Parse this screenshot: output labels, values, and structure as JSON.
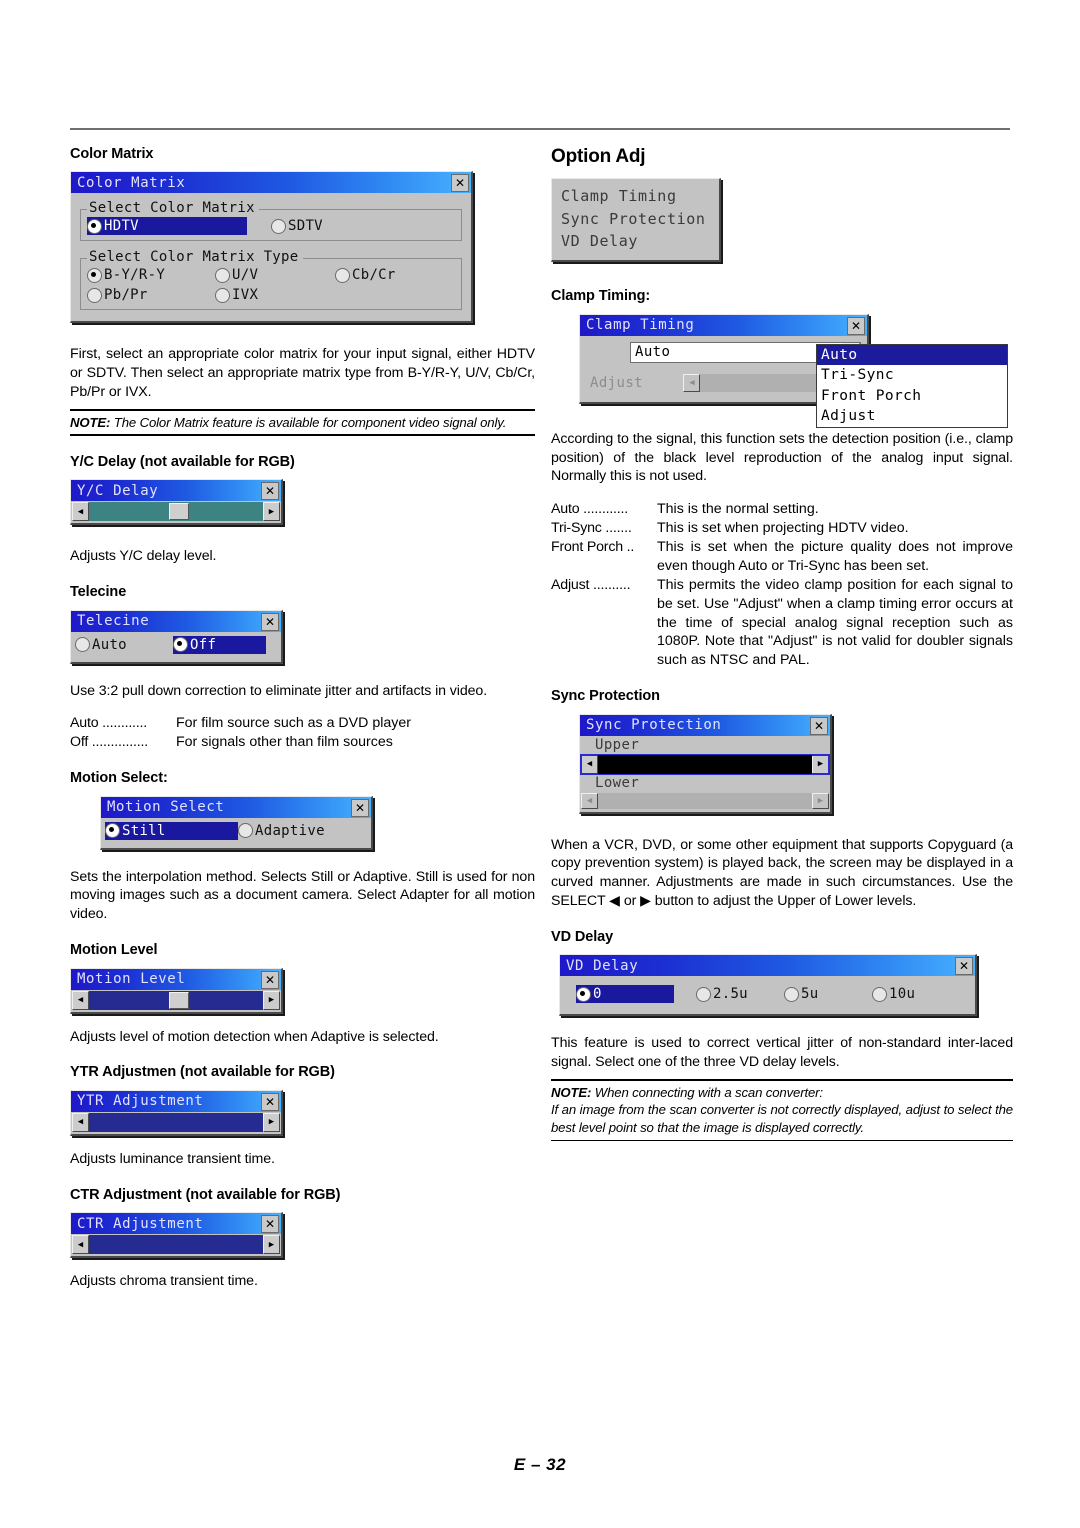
{
  "page": {
    "footer": "E – 32"
  },
  "left": {
    "color_matrix": {
      "heading": "Color Matrix",
      "dialog": {
        "title": "Color Matrix",
        "close_icon": "close-icon",
        "group1_legend": "Select Color Matrix",
        "group1_options": [
          {
            "label": "HDTV",
            "selected": true
          },
          {
            "label": "SDTV",
            "selected": false
          }
        ],
        "group2_legend": "Select Color Matrix Type",
        "group2_options": [
          {
            "label": "B-Y/R-Y",
            "selected": true
          },
          {
            "label": "U/V",
            "selected": false
          },
          {
            "label": "Cb/Cr",
            "selected": false
          },
          {
            "label": "Pb/Pr",
            "selected": false
          },
          {
            "label": "IVX",
            "selected": false
          }
        ]
      },
      "body": "First, select an appropriate color matrix for your input signal, either HDTV or SDTV. Then select an appropriate matrix type from B-Y/R-Y, U/V, Cb/Cr, Pb/Pr or IVX.",
      "note_prefix": "NOTE:",
      "note_text": " The Color Matrix feature is available for component video signal only."
    },
    "yc_delay": {
      "heading": "Y/C Delay (not available for RGB)",
      "dialog": {
        "title": "Y/C Delay",
        "close_icon": "close-icon"
      },
      "body": "Adjusts Y/C delay level."
    },
    "telecine": {
      "heading": "Telecine",
      "dialog": {
        "title": "Telecine",
        "close_icon": "close-icon",
        "options": [
          {
            "label": "Auto",
            "selected": false
          },
          {
            "label": "Off",
            "selected": true
          }
        ]
      },
      "body": "Use 3:2 pull down correction to eliminate jitter and artifacts in video.",
      "defs": [
        {
          "term": "Auto ............",
          "desc": "For film source such as a DVD player"
        },
        {
          "term": "Off ...............",
          "desc": "For signals other than film sources"
        }
      ]
    },
    "motion_select": {
      "heading": "Motion Select:",
      "dialog": {
        "title": "Motion Select",
        "close_icon": "close-icon",
        "options": [
          {
            "label": "Still",
            "selected": true
          },
          {
            "label": "Adaptive",
            "selected": false
          }
        ]
      },
      "body": "Sets the interpolation method. Selects Still or Adaptive. Still is used for non moving images such as a document camera. Select Adapter for all motion video."
    },
    "motion_level": {
      "heading": "Motion Level",
      "dialog": {
        "title": "Motion Level",
        "close_icon": "close-icon"
      },
      "body": "Adjusts level of motion detection when Adaptive is selected."
    },
    "ytr": {
      "heading": "YTR Adjustmen (not available for RGB)",
      "dialog": {
        "title": "YTR Adjustment",
        "close_icon": "close-icon"
      },
      "body": "Adjusts luminance transient time."
    },
    "ctr": {
      "heading": "CTR Adjustment (not available for RGB)",
      "dialog": {
        "title": "CTR Adjustment",
        "close_icon": "close-icon"
      },
      "body": "Adjusts chroma transient time."
    }
  },
  "right": {
    "option_adj": {
      "heading": "Option Adj",
      "menu_items": [
        "Clamp Timing",
        "Sync Protection",
        "VD Delay"
      ]
    },
    "clamp_timing": {
      "heading": "Clamp Timing:",
      "dialog": {
        "title": "Clamp Timing",
        "close_icon": "close-icon",
        "combo_value": "Auto",
        "combo_arrow_icon": "chevron-right-icon",
        "dropdown_options": [
          {
            "label": "Auto",
            "selected": true
          },
          {
            "label": "Tri-Sync",
            "selected": false
          },
          {
            "label": "Front Porch",
            "selected": false
          },
          {
            "label": "Adjust",
            "selected": false
          }
        ],
        "adjust_label": "Adjust"
      },
      "body": "According to the signal, this function sets the detection position (i.e., clamp position) of the black level reproduction of the analog input signal. Normally this is not used.",
      "defs": [
        {
          "term": "Auto ............",
          "desc": "This is the normal setting."
        },
        {
          "term": "Tri-Sync .......",
          "desc": "This is set when projecting HDTV video."
        },
        {
          "term": "Front Porch ..",
          "desc": "This is set when the picture quality does not improve even though Auto or Tri-Sync has been set."
        },
        {
          "term": "Adjust ..........",
          "desc": "This permits the video clamp position for each signal to be set. Use \"Adjust\" when a clamp timing error occurs at the time of special analog signal reception such as 1080P. Note that \"Adjust\" is not valid for doubler signals such as NTSC and PAL."
        }
      ]
    },
    "sync_protection": {
      "heading": "Sync Protection",
      "dialog": {
        "title": "Sync Protection",
        "close_icon": "close-icon",
        "upper_label": "Upper",
        "lower_label": "Lower"
      },
      "body": "When a VCR, DVD, or some other equipment that supports Copyguard (a copy prevention system) is played back, the screen may be displayed in a curved manner. Adjustments are made in such circumstances. Use the SELECT ◀ or ▶ button to adjust the Upper of Lower levels."
    },
    "vd_delay": {
      "heading": "VD Delay",
      "dialog": {
        "title": "VD Delay",
        "close_icon": "close-icon",
        "options": [
          {
            "label": "0",
            "selected": true
          },
          {
            "label": "2.5u",
            "selected": false
          },
          {
            "label": "5u",
            "selected": false
          },
          {
            "label": "10u",
            "selected": false
          }
        ]
      },
      "body": "This feature is used to correct vertical jitter of non-standard inter-laced signal. Select one of the three VD delay levels.",
      "note_prefix": "NOTE:",
      "note_title": " When connecting with a scan converter:",
      "note_text": "If an image from the scan converter is not correctly displayed, adjust to select the best level point so that the image is displayed correctly."
    }
  }
}
